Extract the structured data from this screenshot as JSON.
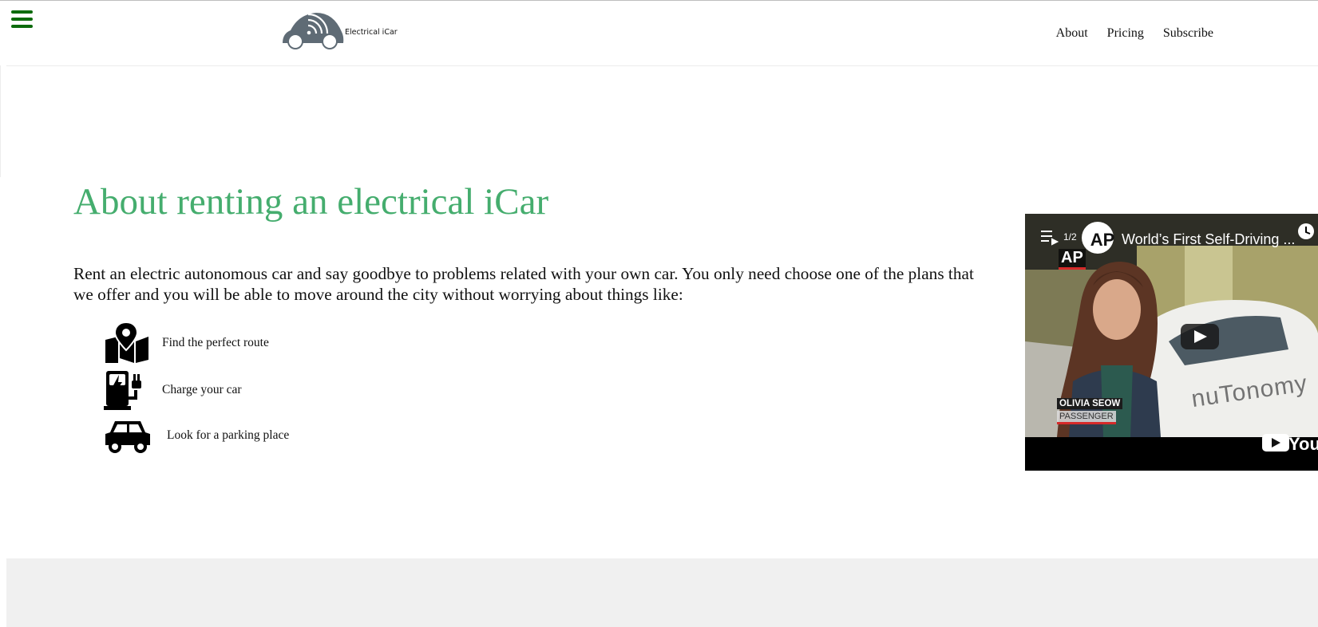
{
  "header": {
    "logo_text": "Electrical iCar",
    "nav": [
      {
        "label": "About"
      },
      {
        "label": "Pricing"
      },
      {
        "label": "Subscribe"
      }
    ]
  },
  "main": {
    "title": "About renting an electrical iCar",
    "intro": "Rent an electric autonomous car and say goodbye to problems related with your own car. You only need choose one of the plans that we offer and you will be able to move around the city without worrying about things like:",
    "features": [
      {
        "icon": "map-pin-icon",
        "label": "Find the perfect route"
      },
      {
        "icon": "charging-station-icon",
        "label": "Charge your car"
      },
      {
        "icon": "car-icon",
        "label": "Look for a parking place"
      }
    ]
  },
  "video": {
    "counter": "1/2",
    "channel_badge": "AP",
    "title": "World’s First Self-Driving ...",
    "corner_logo": "AP",
    "lower_third_name": "OLIVIA SEOW",
    "lower_third_role": "PASSENGER",
    "car_brand": "nuTonomy",
    "watermark": "You"
  },
  "colors": {
    "title_green": "#45ad6e",
    "menu_green": "#0d6b0d",
    "logo_gray": "#5f6b75",
    "footer_bg": "#f0f0f0"
  }
}
